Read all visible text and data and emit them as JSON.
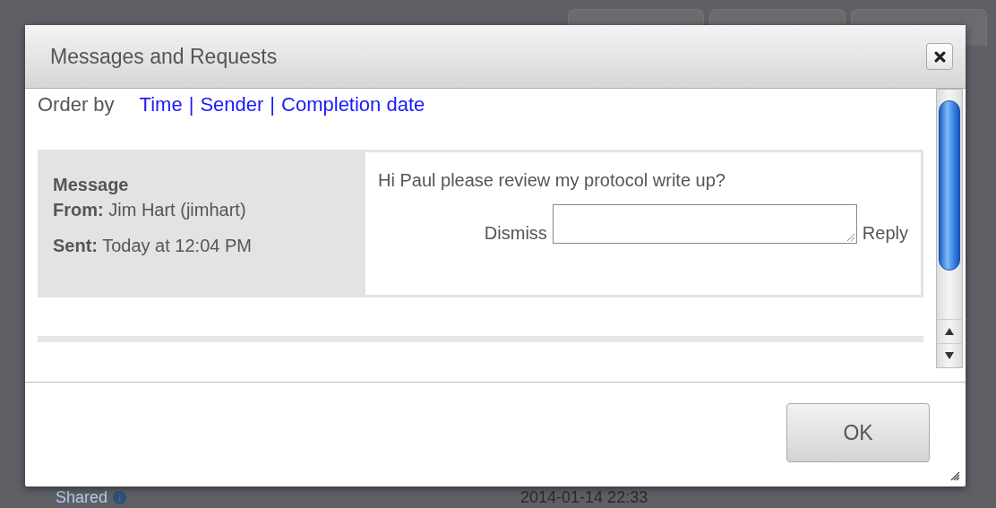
{
  "background": {
    "footer_left": "Shared",
    "footer_right": "2014-01-14 22:33"
  },
  "dialog": {
    "title": "Messages and Requests",
    "order_by": {
      "label": "Order by",
      "separator": "|",
      "options": [
        {
          "label": "Time"
        },
        {
          "label": "Sender"
        },
        {
          "label": "Completion date"
        }
      ]
    },
    "messages": [
      {
        "heading": "Message",
        "from": "**From:** Jim Hart (jimhart)",
        "sent": "**Sent:** Today at 12:04 PM",
        "body": "Hi Paul please review my protocol write up?",
        "dismiss": "Dismiss",
        "reply": "Reply"
      }
    ],
    "ok": "OK"
  }
}
